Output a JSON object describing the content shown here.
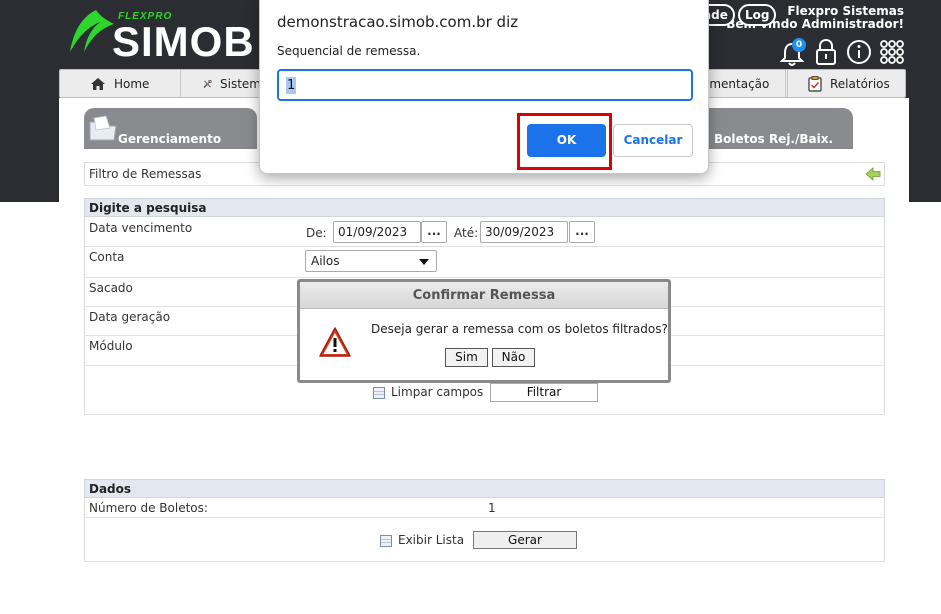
{
  "header": {
    "logo_small": "FLEXPRO",
    "logo_big": "SIMOB",
    "company": "Flexpro Sistemas",
    "welcome": "Bem vindo Administrador!",
    "pill_partial": "ade",
    "pill_log": "Log",
    "notification_count": "0"
  },
  "nav": {
    "home": "Home",
    "sistema_partial": "Sistem",
    "movimentacao_partial": "imentação",
    "relatorios": "Relatórios"
  },
  "tabs": {
    "gerenciamento": "Gerenciamento",
    "boletos_rej": "Boletos Rej./Baix."
  },
  "filtro": {
    "title": "Filtro de Remessas"
  },
  "pesquisa": {
    "section_title": "Digite a pesquisa",
    "data_vencimento_label": "Data vencimento",
    "de_label": "De:",
    "de_value": "01/09/2023",
    "ate_label": "Até:",
    "ate_value": "30/09/2023",
    "dots": "...",
    "conta_label": "Conta",
    "conta_value": "Ailos",
    "sacado_label": "Sacado",
    "data_geracao_label": "Data geração",
    "modulo_label": "Módulo",
    "limpar_label": "Limpar campos",
    "filtrar_label": "Filtrar"
  },
  "dados": {
    "section_title": "Dados",
    "numero_boletos_label": "Número de Boletos:",
    "numero_boletos_value": "1",
    "exibir_lista_label": "Exibir Lista",
    "gerar_label": "Gerar"
  },
  "confirm_dialog": {
    "title": "Confirmar Remessa",
    "message": "Deseja gerar a remessa com os boletos filtrados?",
    "yes": "Sim",
    "no": "Não"
  },
  "prompt_dialog": {
    "title": "demonstracao.simob.com.br diz",
    "message": "Sequencial de remessa.",
    "input_value": "1",
    "ok": "OK",
    "cancel": "Cancelar"
  },
  "colors": {
    "header_bg": "#2b2d33",
    "logo_green": "#2dd62d",
    "accent_blue": "#1a73e8",
    "highlight_red": "#e00000",
    "tab_gray": "#898b8f"
  }
}
